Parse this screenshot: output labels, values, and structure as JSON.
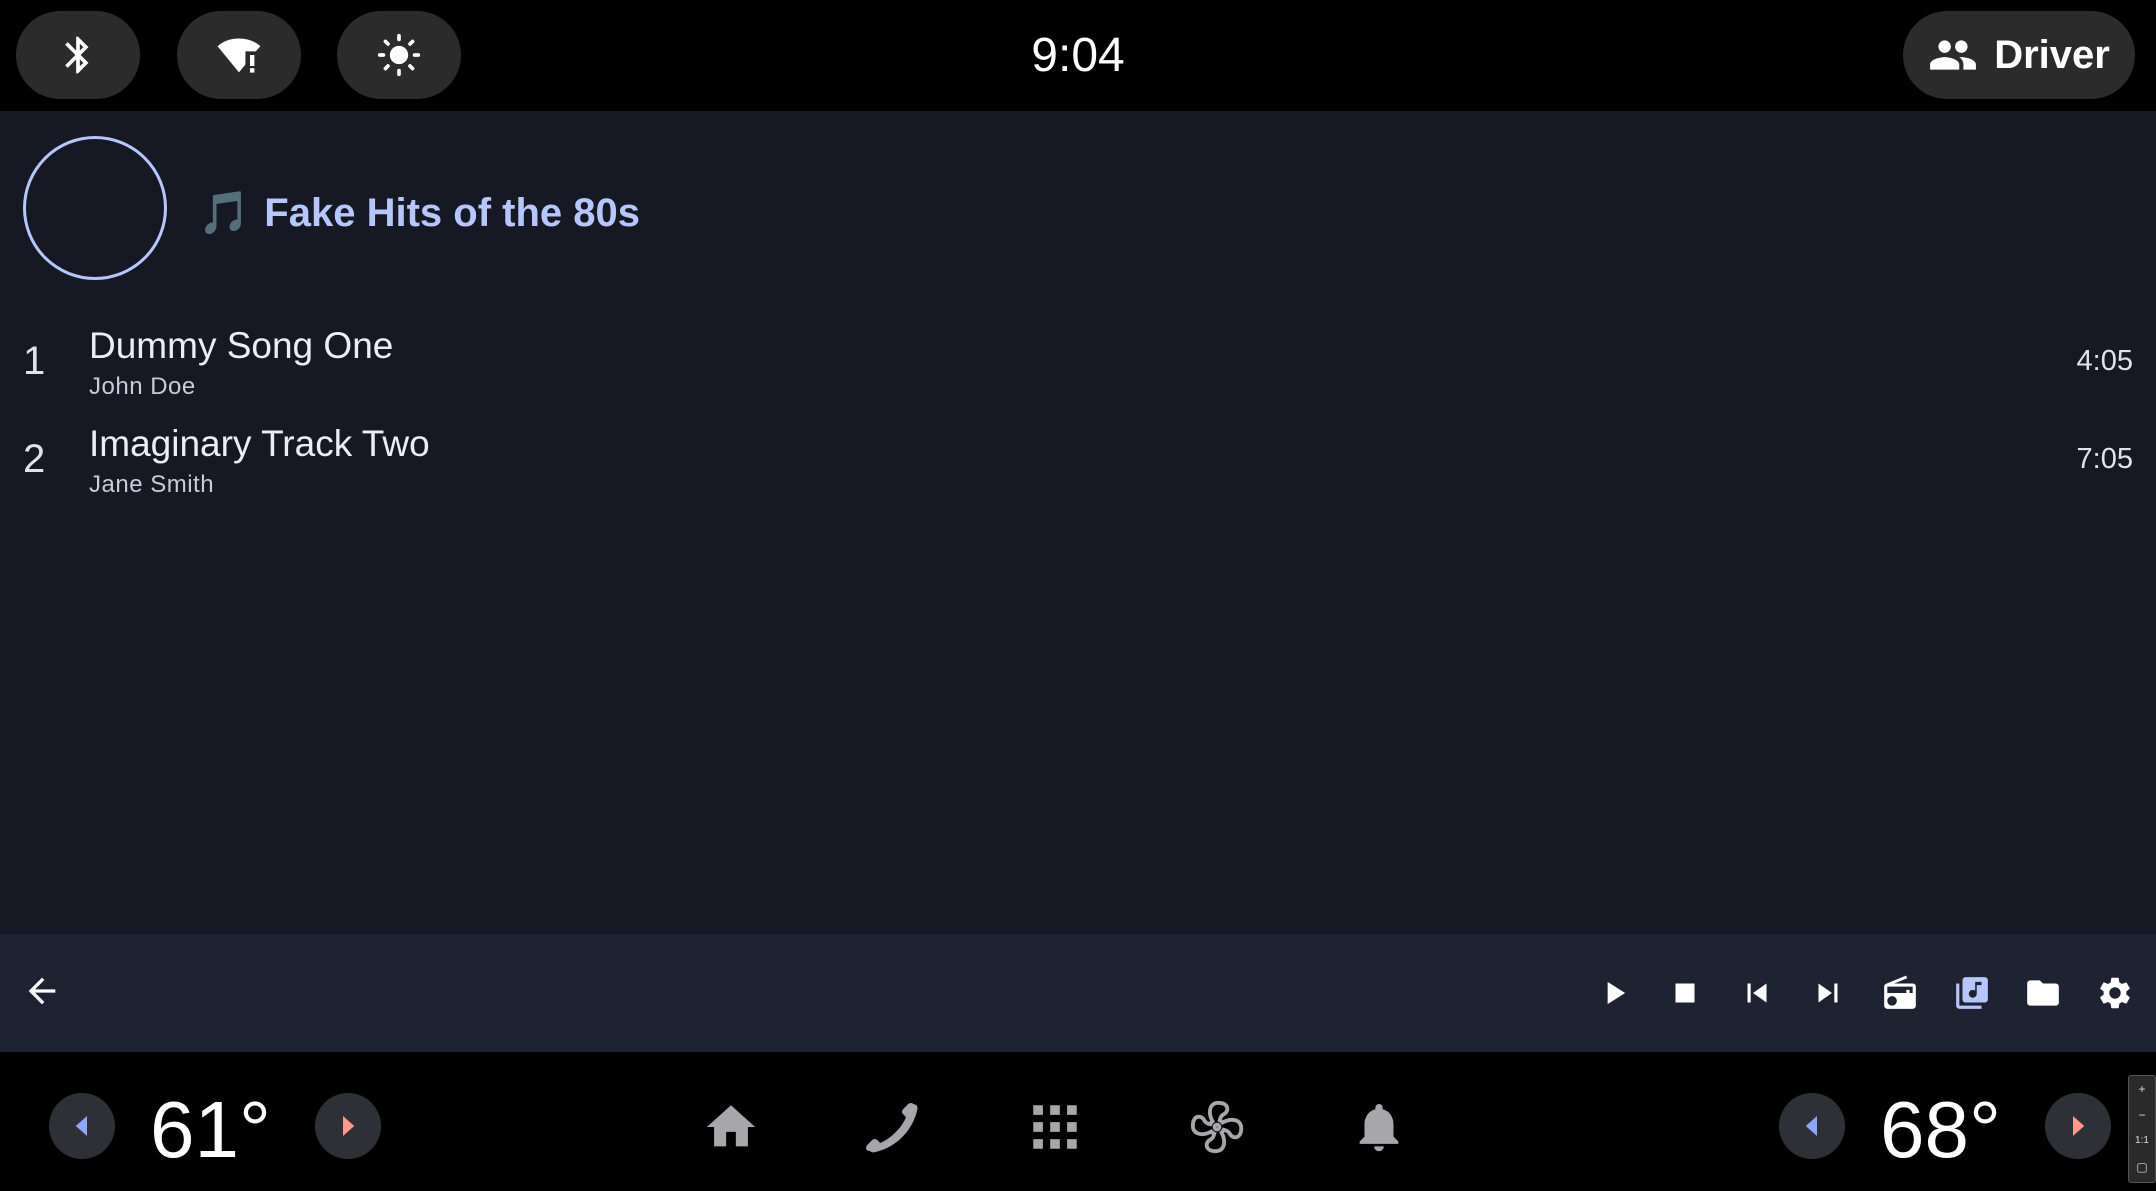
{
  "status_bar": {
    "clock": "9:04",
    "quick_settings": [
      {
        "icon": "bluetooth-icon"
      },
      {
        "icon": "wifi-alert-icon"
      },
      {
        "icon": "brightness-icon"
      }
    ],
    "profile": {
      "icon": "people-icon",
      "label": "Driver"
    }
  },
  "media": {
    "playlist_icon": "🎵",
    "playlist_title": "Fake Hits of the 80s",
    "tracks": [
      {
        "number": "1",
        "title": "Dummy Song One",
        "artist": "John Doe",
        "duration": "4:05"
      },
      {
        "number": "2",
        "title": "Imaginary Track Two",
        "artist": "Jane Smith",
        "duration": "7:05"
      }
    ]
  },
  "controls": {
    "back": "arrow-back-icon",
    "buttons": [
      "play-icon",
      "stop-icon",
      "skip-previous-icon",
      "skip-next-icon",
      "radio-icon",
      "library-music-icon",
      "folder-icon",
      "settings-icon"
    ],
    "active": "library-music-icon"
  },
  "nav_bar": {
    "left_temp": "61°",
    "right_temp": "68°",
    "icons": [
      "home-icon",
      "phone-icon",
      "apps-grid-icon",
      "fan-icon",
      "notifications-icon"
    ]
  },
  "zoom_strip": {
    "plus": "+",
    "minus": "−",
    "ratio": "1:1"
  },
  "colors": {
    "accent": "#b6c6ff",
    "content_bg": "#161823",
    "control_bar_bg": "#1f2230",
    "temp_decrease": "#8ea6ff",
    "temp_increase": "#ff9a8a"
  }
}
